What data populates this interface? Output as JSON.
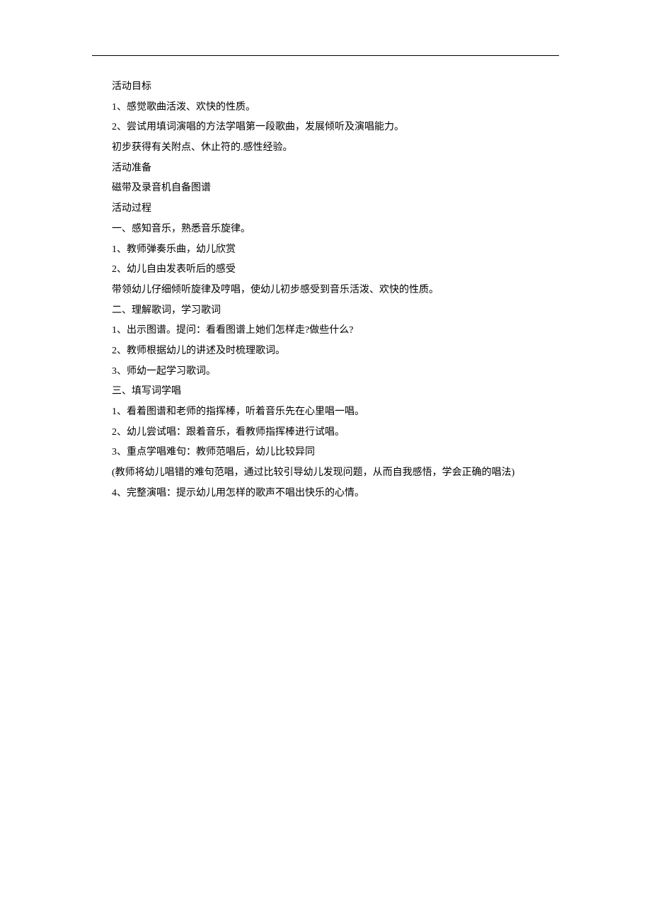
{
  "lines": [
    "活动目标",
    "1、感觉歌曲活泼、欢快的性质。",
    "2、尝试用填词演唱的方法学唱第一段歌曲，发展倾听及演唱能力。",
    "初步获得有关附点、休止符的.感性经验。",
    "活动准备",
    "磁带及录音机自备图谱",
    "活动过程",
    "一、感知音乐，熟悉音乐旋律。",
    "1、教师弹奏乐曲，幼儿欣赏",
    "2、幼儿自由发表听后的感受",
    "带领幼儿仔细倾听旋律及哼唱，使幼儿初步感受到音乐活泼、欢快的性质。",
    "二、理解歌词，学习歌词",
    "1、出示图谱。提问：看看图谱上她们怎样走?做些什么?",
    "2、教师根据幼儿的讲述及时梳理歌词。",
    "3、师幼一起学习歌词。",
    "三、填写词学唱",
    "1、看着图谱和老师的指挥棒，听着音乐先在心里唱一唱。",
    "2、幼儿尝试唱：跟着音乐，看教师指挥棒进行试唱。",
    "3、重点学唱难句：教师范唱后，幼儿比较异同",
    "(教师将幼儿唱错的难句范唱，通过比较引导幼儿发现问题，从而自我感悟，学会正确的唱法)",
    "4、完整演唱：提示幼儿用怎样的歌声不唱出快乐的心情。"
  ]
}
